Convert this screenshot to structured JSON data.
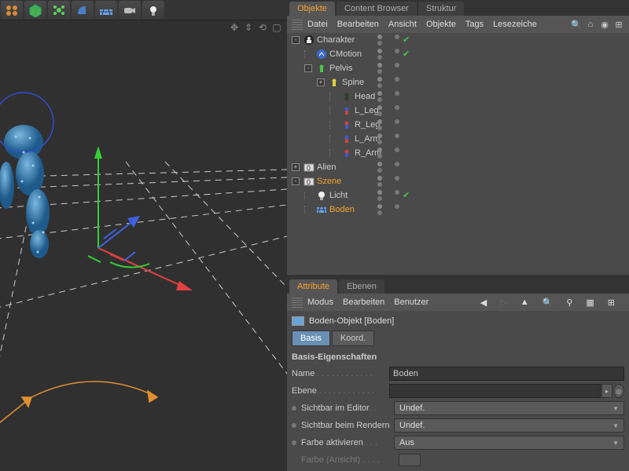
{
  "toolbar": {
    "items": [
      "array-tool",
      "cube-tool",
      "cloner-tool",
      "volume-tool",
      "floor-tool",
      "camera-tool",
      "light-tool"
    ]
  },
  "viewport": {
    "nav_icons": [
      "pan-icon",
      "zoom-icon",
      "rotate-icon",
      "frame-icon"
    ]
  },
  "objects_panel": {
    "tabs": {
      "objekte": "Objekte",
      "content": "Content Browser",
      "struktur": "Struktur"
    },
    "menus": {
      "datei": "Datei",
      "bearbeiten": "Bearbeiten",
      "ansicht": "Ansicht",
      "objekte": "Objekte",
      "tags": "Tags",
      "lesez": "Lesezeiche"
    },
    "hierarchy": [
      {
        "name": "Charakter",
        "depth": 0,
        "expander": "-",
        "icon": "character-icon",
        "sel": false,
        "check": true
      },
      {
        "name": "CMotion",
        "depth": 1,
        "expander": "",
        "icon": "cmotion-icon",
        "sel": false,
        "check": true
      },
      {
        "name": "Pelvis",
        "depth": 1,
        "expander": "-",
        "icon": "joint-green-icon",
        "sel": false,
        "check": false
      },
      {
        "name": "Spine",
        "depth": 2,
        "expander": "+",
        "icon": "joint-yellow-icon",
        "sel": false,
        "check": false
      },
      {
        "name": "Head",
        "depth": 3,
        "expander": "",
        "icon": "joint-dark-icon",
        "sel": false,
        "check": false
      },
      {
        "name": "L_Leg",
        "depth": 3,
        "expander": "",
        "icon": "joint-blue-icon",
        "sel": false,
        "check": false
      },
      {
        "name": "R_Leg",
        "depth": 3,
        "expander": "",
        "icon": "joint-red-icon",
        "sel": false,
        "check": false
      },
      {
        "name": "L_Arm",
        "depth": 3,
        "expander": "",
        "icon": "joint-blue-icon",
        "sel": false,
        "check": false
      },
      {
        "name": "R_Arm",
        "depth": 3,
        "expander": "",
        "icon": "joint-red-icon",
        "sel": false,
        "check": false
      },
      {
        "name": "Alien",
        "depth": 0,
        "expander": "+",
        "icon": "layer0-icon",
        "sel": false,
        "check": false
      },
      {
        "name": "Szene",
        "depth": 0,
        "expander": "-",
        "icon": "layer0-icon",
        "sel": true,
        "check": false
      },
      {
        "name": "Licht",
        "depth": 1,
        "expander": "",
        "icon": "light-icon",
        "sel": false,
        "check": true
      },
      {
        "name": "Boden",
        "depth": 1,
        "expander": "",
        "icon": "floor-icon",
        "sel": true,
        "check": false
      }
    ]
  },
  "attributes_panel": {
    "tabs": {
      "attribute": "Attribute",
      "ebenen": "Ebenen"
    },
    "menus": {
      "modus": "Modus",
      "bearbeiten": "Bearbeiten",
      "benutzer": "Benutzer"
    },
    "header": "Boden-Objekt [Boden]",
    "sub_tabs": {
      "basis": "Basis",
      "koord": "Koord."
    },
    "group_title": "Basis-Eigenschaften",
    "props": {
      "name_label": "Name",
      "name_value": "Boden",
      "ebene_label": "Ebene",
      "ebene_value": "",
      "sicht_edit_label": "Sichtbar im Editor",
      "sicht_edit_value": "Undef.",
      "sicht_ren_label": "Sichtbar beim Rendern",
      "sicht_ren_value": "Undef.",
      "farbe_akt_label": "Farbe aktivieren",
      "farbe_akt_value": "Aus",
      "farbe_ansicht_label": "Farbe (Ansicht)"
    }
  }
}
